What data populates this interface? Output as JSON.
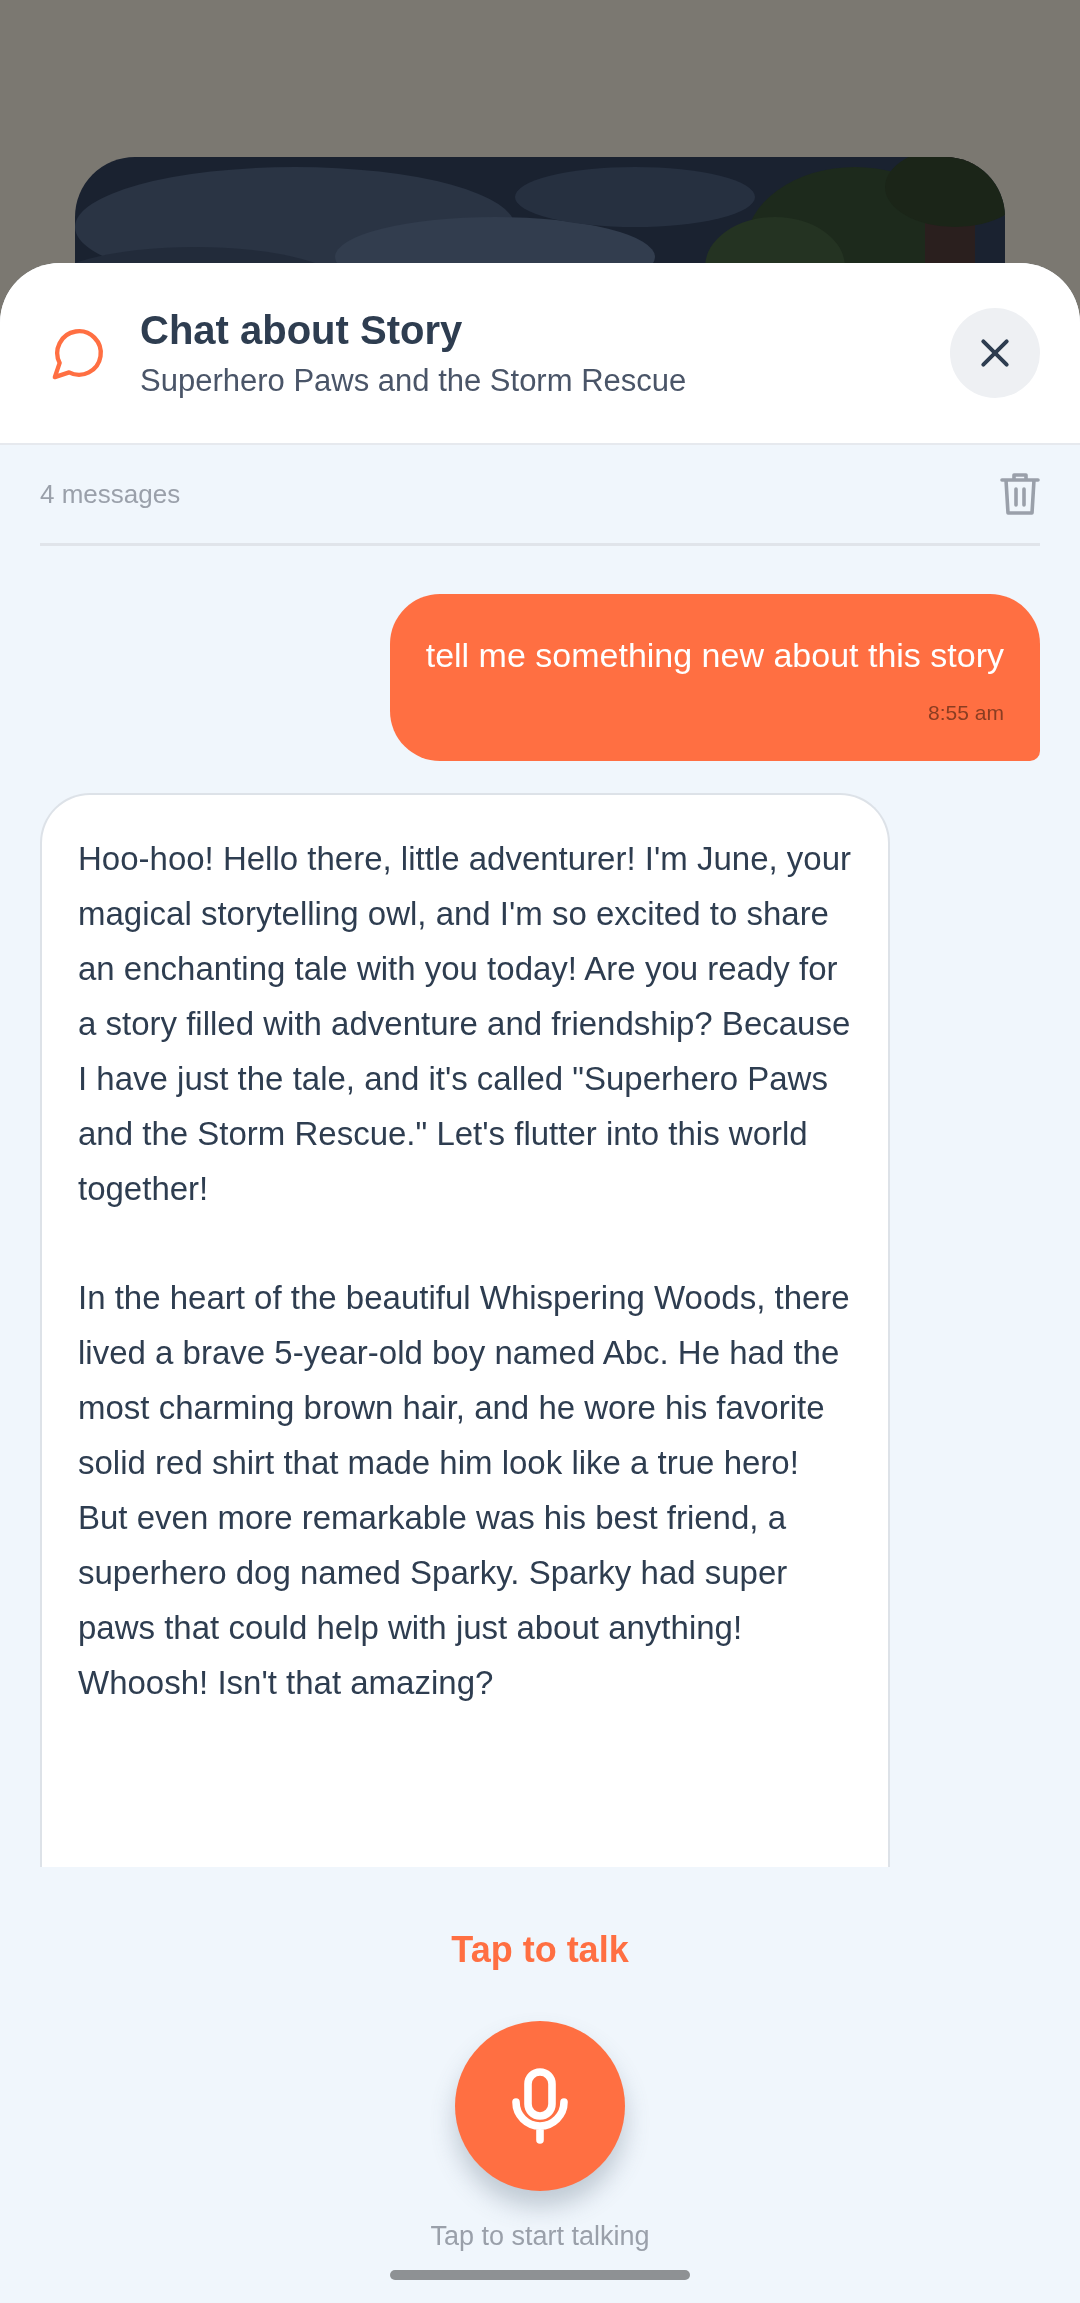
{
  "header": {
    "title": "Chat about Story",
    "subtitle": "Superhero Paws and the Storm Rescue"
  },
  "message_count": "4 messages",
  "messages": [
    {
      "kind": "user",
      "text": "tell me something new about this story",
      "time": "8:55 am"
    },
    {
      "kind": "assistant",
      "paragraphs": [
        "Hoo-hoo! Hello there, little adventurer! I'm June, your magical storytelling owl, and I'm so excited to share an enchanting tale with you today! Are you ready for a story filled with adventure and friendship? Because I have just the tale, and it's called \"Superhero Paws and the Storm Rescue.\" Let's flutter into this world together!",
        "In the heart of the beautiful Whispering Woods, there lived a brave 5-year-old boy named Abc. He had the most charming brown hair, and he wore his favorite solid red shirt that made him look like a true hero! But even more remarkable was his best friend, a superhero dog named Sparky. Sparky had super paws that could help with just about anything! Whoosh! Isn't that amazing?"
      ]
    }
  ],
  "talk": {
    "title": "Tap to talk",
    "hint": "Tap to start talking"
  }
}
